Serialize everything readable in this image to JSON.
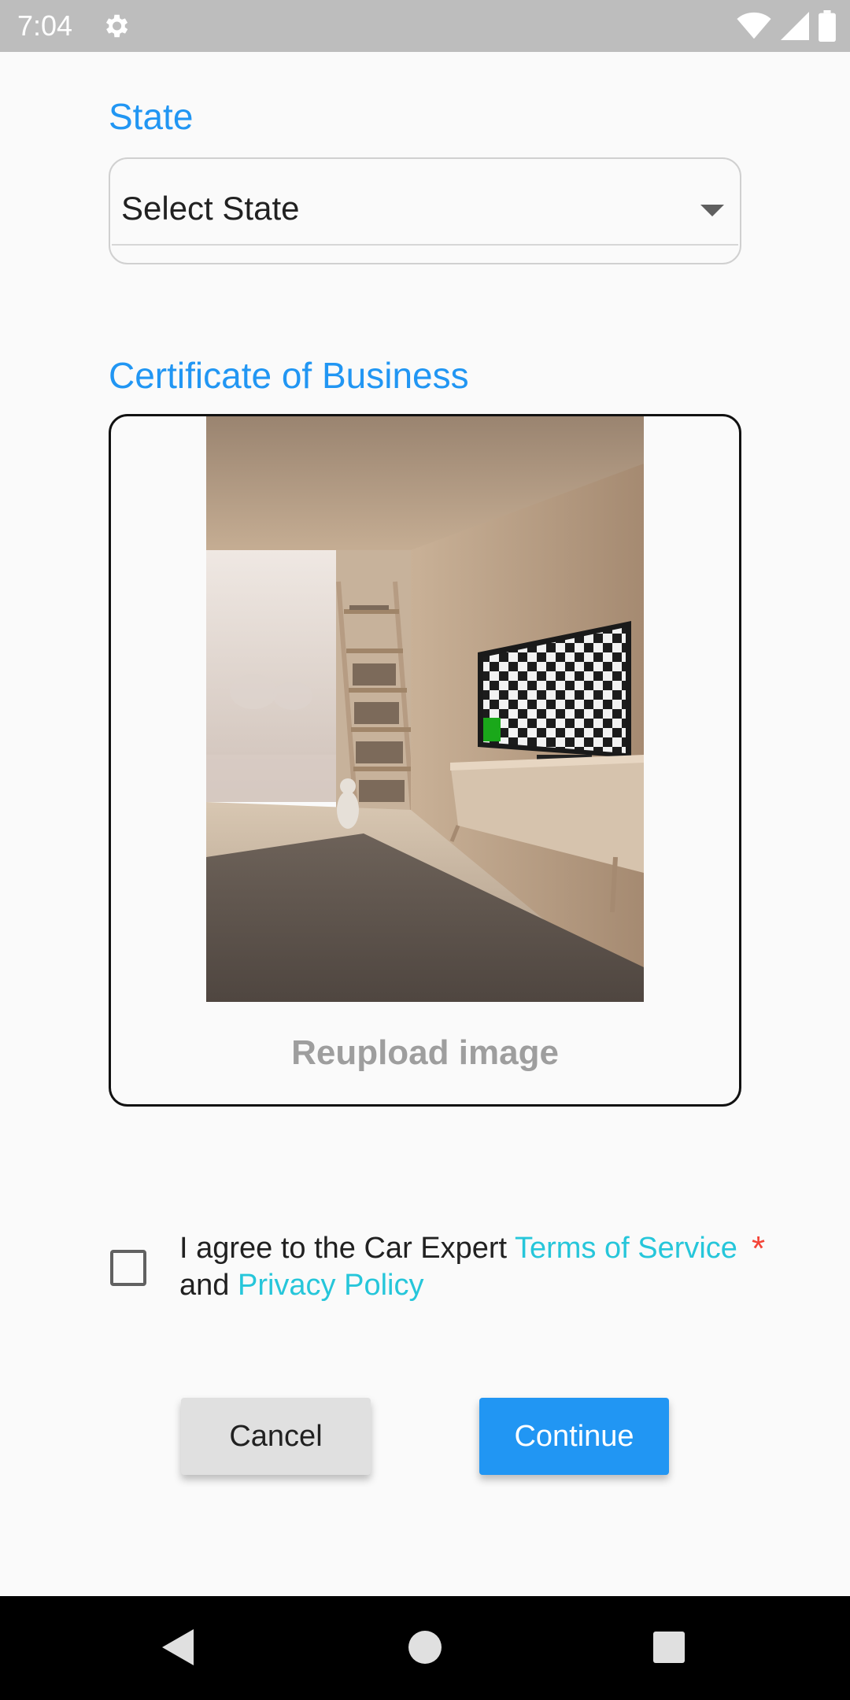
{
  "status_bar": {
    "time": "7:04",
    "icons": [
      "gear-icon",
      "wifi-icon",
      "signal-icon",
      "battery-icon"
    ]
  },
  "form": {
    "state": {
      "label": "State",
      "select_value": "Select State"
    },
    "certificate": {
      "label": "Certificate of Business",
      "reupload_label": "Reupload image"
    },
    "agreement": {
      "prefix": "I agree to the Car Expert ",
      "terms_link": "Terms of Service",
      "middle": "and ",
      "privacy_link": "Privacy Policy",
      "required_mark": "*",
      "checked": false
    },
    "buttons": {
      "cancel_label": "Cancel",
      "continue_label": "Continue"
    }
  },
  "colors": {
    "accent": "#2196f3",
    "link": "#26c6da",
    "required": "#f44336",
    "status_bar": "#bdbdbd"
  },
  "nav_bar": {
    "icons": [
      "back-icon",
      "home-icon",
      "recent-apps-icon"
    ]
  }
}
